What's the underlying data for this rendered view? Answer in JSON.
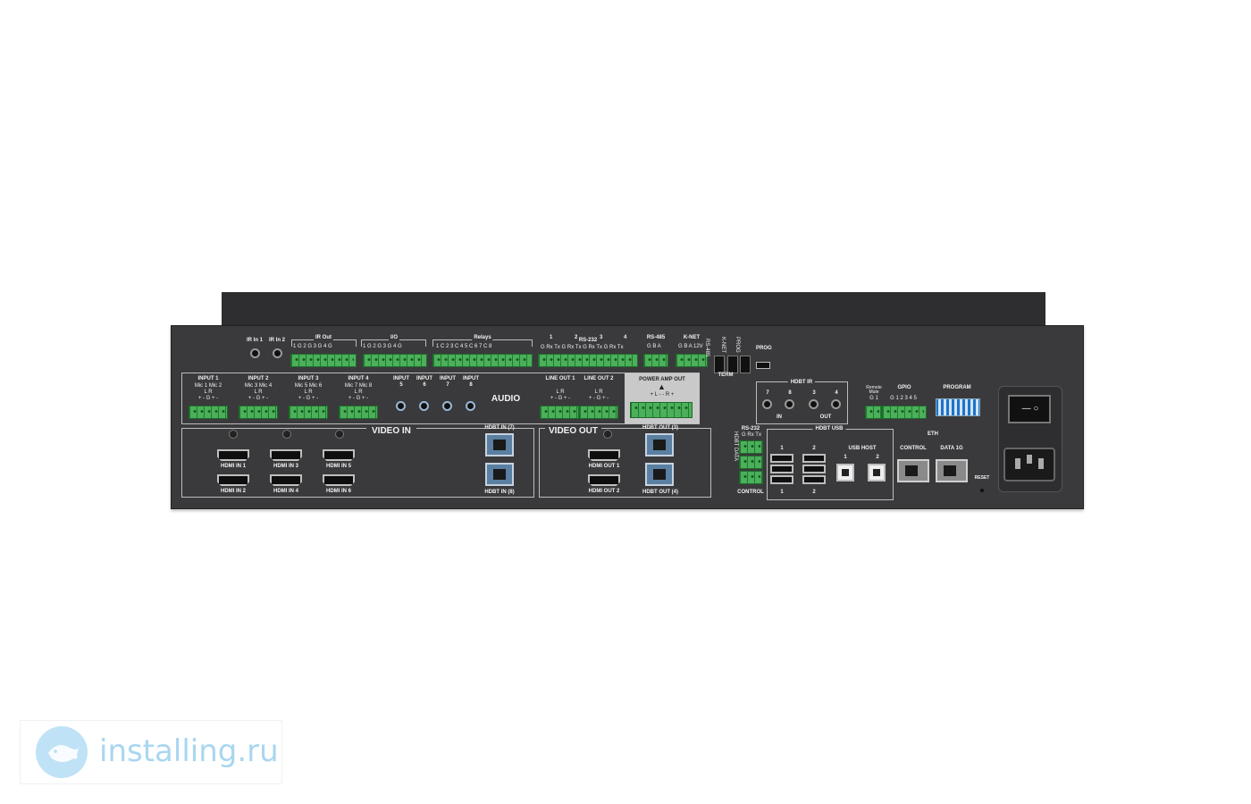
{
  "watermark": {
    "text": "installing.ru",
    "logo_icon": "fish-logo-icon",
    "color": "#4aa7df"
  },
  "device": {
    "top_labels": {
      "ir_in_1": "IR In 1",
      "ir_in_2": "IR In 2",
      "ir_out": "IR Out",
      "ir_out_pins": "1 G 2 G  3 G 4 G",
      "io": "I/O",
      "io_pins": "1 G 2 G  3 G 4 G",
      "relays": "Relays",
      "relays_pins": "1 C 2  3 C 4  5 C 6  7 C 8",
      "rs232": "RS-232",
      "rs232_pins": "G Rx Tx  G Rx Tx  G Rx Tx  G Rx Tx",
      "rs232_n1": "1",
      "rs232_n2": "2",
      "rs232_n3": "3",
      "rs232_n4": "4",
      "rs485": "RS-485",
      "rs485_pins": "G B A",
      "knet": "K-NET",
      "knet_pins": "G B A 12V",
      "rs485_vert": "RS-485",
      "knet_vert": "K-NET",
      "prog_vert": "PROG",
      "term": "TERM",
      "prog": "PROG"
    },
    "audio": {
      "title": "AUDIO",
      "inputs": [
        {
          "name": "INPUT 1",
          "mics": "Mic 1   Mic 2",
          "lr": "L        R",
          "pins": "+ -  G +  -"
        },
        {
          "name": "INPUT 2",
          "mics": "Mic 3   Mic 4",
          "lr": "L        R",
          "pins": "+ -  G +  -"
        },
        {
          "name": "INPUT 3",
          "mics": "Mic 5   Mic 6",
          "lr": "L        R",
          "pins": "+ -  G +  -"
        },
        {
          "name": "INPUT 4",
          "mics": "Mic 7   Mic 8",
          "lr": "L        R",
          "pins": "+ -  G +  -"
        }
      ],
      "jacks": [
        {
          "name": "INPUT",
          "num": "5"
        },
        {
          "name": "INPUT",
          "num": "6"
        },
        {
          "name": "INPUT",
          "num": "7"
        },
        {
          "name": "INPUT",
          "num": "8"
        }
      ],
      "line_out_1": "LINE OUT 1",
      "line_out_2": "LINE OUT 2",
      "line_out_lr": "L     R",
      "line_out_pins": "+ -  G +  -",
      "power_amp_out": "POWER AMP OUT",
      "power_amp_pins": "+  L  -     -  R  +"
    },
    "video_in": {
      "title": "VIDEO IN",
      "hdmi": [
        "HDMI IN 1",
        "HDMI IN 3",
        "HDMI IN 5",
        "HDMI IN 2",
        "HDMI IN 4",
        "HDMI IN 6"
      ],
      "hdbt_in_7": "HDBT IN (7)",
      "hdbt_in_8": "HDBT IN (8)"
    },
    "video_out": {
      "title": "VIDEO OUT",
      "hdmi": [
        "HDMI OUT 1",
        "HDMI OUT 2"
      ],
      "hdbt_out_3": "HDBT OUT (3)",
      "hdbt_out_4": "HDBT OUT (4)"
    },
    "hdbt_ir": {
      "title": "HDBT IR",
      "nums": [
        "7",
        "8",
        "3",
        "4"
      ],
      "in": "IN",
      "out": "OUT"
    },
    "hdbt_data": {
      "vert": "HDBT DATA",
      "rs232": "RS-232",
      "pins": "G Rx Tx",
      "control": "CONTROL"
    },
    "hdbt_usb": {
      "title": "HDBT USB",
      "n1": "1",
      "n2": "2",
      "b1": "1",
      "b2": "2"
    },
    "usb_host": {
      "title": "USB HOST",
      "n1": "1",
      "n2": "2"
    },
    "remote_mute": {
      "line1": "Remote",
      "line2": "Mute",
      "pins": "G 1"
    },
    "gpio": {
      "title": "GPIO",
      "pins": "G 1 2 3 4 5"
    },
    "program": {
      "title": "PROGRAM"
    },
    "eth": {
      "title": "ETH",
      "control": "CONTROL",
      "data": "DATA 1G",
      "reset": "RESET"
    },
    "power": {
      "switch_symbols": "— ○"
    }
  }
}
